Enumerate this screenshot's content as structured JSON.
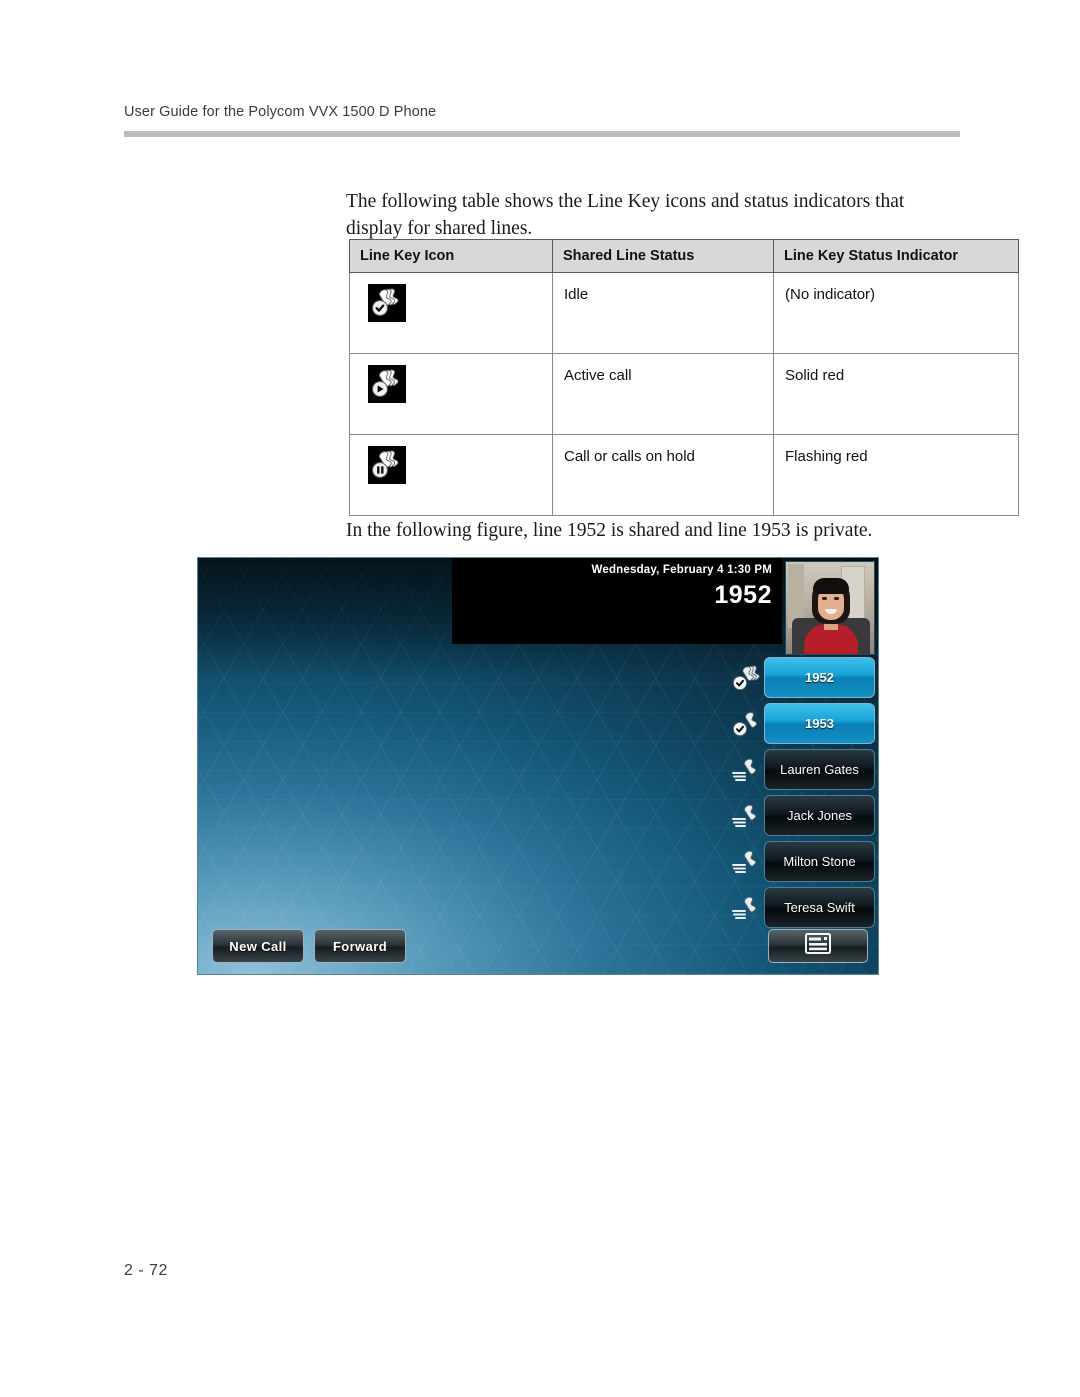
{
  "document": {
    "running_head": "User Guide for the Polycom VVX 1500 D Phone",
    "page_number": "2 - 72"
  },
  "content": {
    "intro_paragraph": "The following table shows the Line Key icons and status indicators that display for shared lines.",
    "figure_intro_paragraph": "In the following figure, line 1952 is shared and line 1953 is private."
  },
  "table": {
    "headers": [
      "Line Key Icon",
      "Shared Line Status",
      "Line Key Status Indicator"
    ],
    "rows": [
      {
        "icon": "shared-line-idle-icon",
        "badge": "check",
        "status": "Idle",
        "indicator": "(No indicator)"
      },
      {
        "icon": "shared-line-active-icon",
        "badge": "play",
        "status": "Active call",
        "indicator": "Solid red"
      },
      {
        "icon": "shared-line-hold-icon",
        "badge": "pause",
        "status": "Call or calls on hold",
        "indicator": "Flashing red"
      }
    ]
  },
  "phone_screen": {
    "status_bar": {
      "datetime": "Wednesday, February 4  1:30 PM",
      "extension": "1952"
    },
    "video_thumbnail_label": "self-view-video",
    "line_keys": [
      {
        "label": "1952",
        "icon": "shared-line-idle-icon",
        "type": "registered"
      },
      {
        "label": "1953",
        "icon": "private-line-idle-icon",
        "type": "registered"
      },
      {
        "label": "Lauren Gates",
        "icon": "speed-dial-icon",
        "type": "contact"
      },
      {
        "label": "Jack Jones",
        "icon": "speed-dial-icon",
        "type": "contact"
      },
      {
        "label": "Milton Stone",
        "icon": "speed-dial-icon",
        "type": "contact"
      },
      {
        "label": "Teresa Swift",
        "icon": "speed-dial-icon",
        "type": "contact"
      }
    ],
    "soft_keys": [
      "New Call",
      "Forward"
    ],
    "menu_key_icon": "menu-window-icon"
  },
  "colors": {
    "header_rule": "#bcbcbc",
    "table_header_fill": "#d8d8d8",
    "table_border": "#8a8a8a",
    "line_key_active": "#19a5d8",
    "line_key_contact": "#10181d",
    "status_bar": "#000000"
  }
}
